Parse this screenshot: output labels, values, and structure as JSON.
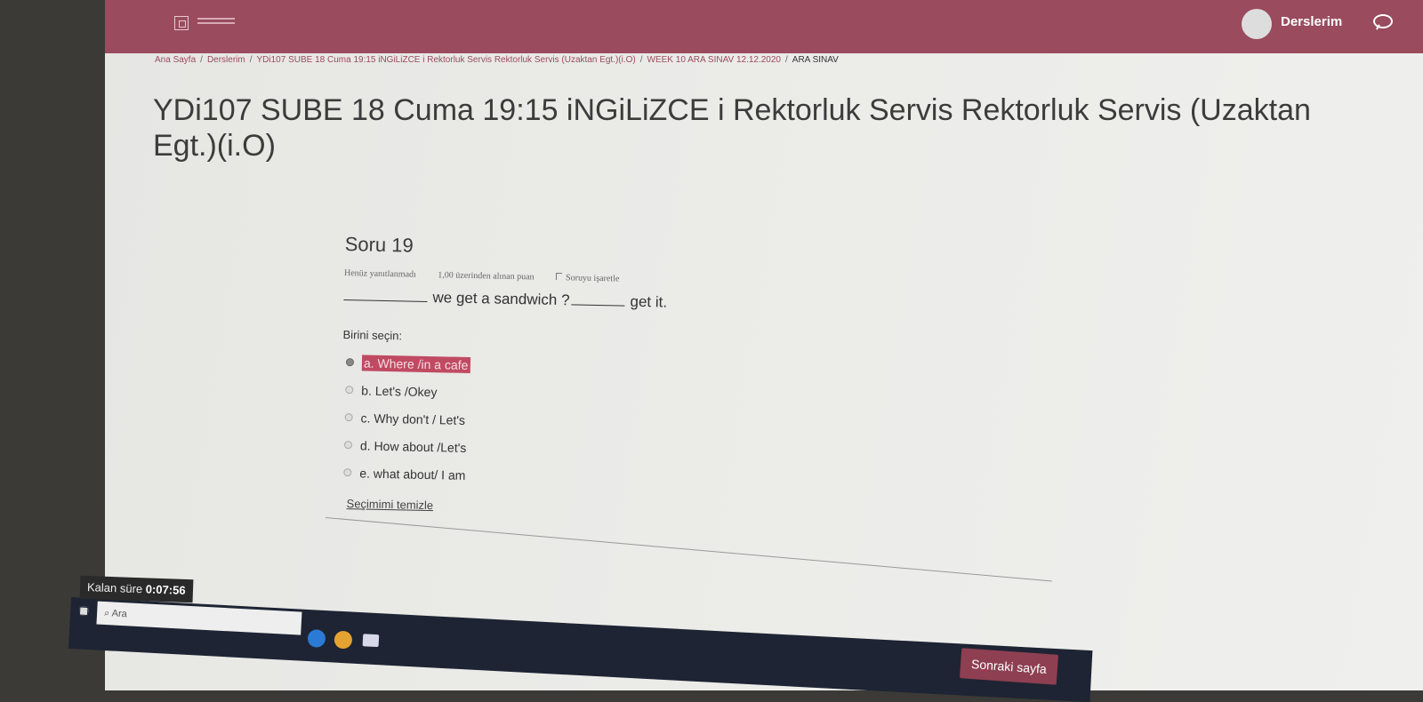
{
  "nav": {
    "user_link": "Derslerim"
  },
  "breadcrumb": [
    "Ana Sayfa",
    "Derslerim",
    "YDi107 SUBE 18 Cuma 19:15 iNGiLiZCE i Rektorluk Servis Rektorluk Servis (Uzaktan Egt.)(i.O)",
    "WEEK 10 ARA SINAV 12.12.2020",
    "ARA SINAV"
  ],
  "breadcrumb_sep": "/",
  "page_title": "YDi107 SUBE 18 Cuma 19:15 iNGiLiZCE i Rektorluk Servis Rektorluk Servis (Uzaktan Egt.)(i.O)",
  "question": {
    "number": "Soru 19",
    "status": "Henüz yanıtlanmadı",
    "points": "1,00 üzerinden alınan puan",
    "flag": "Soruyu işaretle",
    "text_part1": "we get a sandwich ?",
    "text_part2": "get it.",
    "prompt": "Birini seçin:",
    "options": [
      {
        "label": "a. Where /in a cafe",
        "selected": true
      },
      {
        "label": "b. Let's /Okey",
        "selected": false
      },
      {
        "label": "c. Why don't / Let's",
        "selected": false
      },
      {
        "label": "d. How about /Let's",
        "selected": false
      },
      {
        "label": "e. what about/ I am",
        "selected": false
      }
    ],
    "clear_link": "Seçimimi temizle"
  },
  "timer": {
    "label": "Kalan süre",
    "value": "0:07:56"
  },
  "next_button": "Sonraki sayfa",
  "taskbar": {
    "search_placeholder": "Ara"
  }
}
